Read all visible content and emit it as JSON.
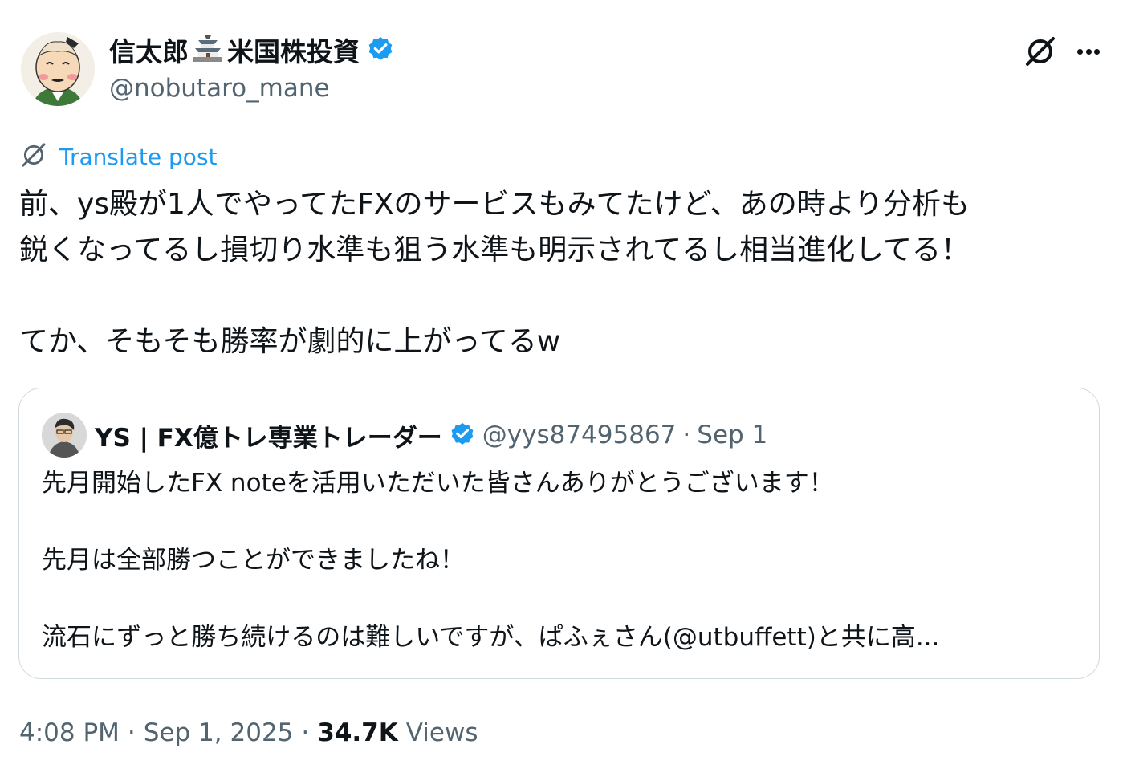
{
  "author": {
    "display_name_prefix": "信太郎",
    "display_name_suffix": "米国株投資",
    "handle": "@nobutaro_mane",
    "icons": [
      "castle-emoji-icon",
      "verified-badge-icon",
      "grok-icon",
      "more-icon"
    ]
  },
  "translate": {
    "label": "Translate post",
    "icon": "translate-icon"
  },
  "tweet": {
    "lines": [
      "前、ys殿が1人でやってたFXのサービスもみてたけど、あの時より分析も",
      "鋭くなってるし損切り水準も狙う水準も明示されてるし相当進化してる！",
      "",
      "てか、そもそも勝率が劇的に上がってるw"
    ]
  },
  "quote": {
    "display_name": "YS | FX億トレ専業トレーダー",
    "handle": "@yys87495867",
    "separator": "·",
    "date": "Sep 1",
    "lines": [
      "先月開始したFX noteを活用いただいた皆さんありがとうございます！",
      "",
      "先月は全部勝つことができましたね！",
      "",
      "流石にずっと勝ち続けるのは難しいですが、ぱふぇさん(@utbuffett)と共に高..."
    ]
  },
  "footer": {
    "time": "4:08 PM",
    "sep1": "·",
    "date": "Sep 1, 2025",
    "sep2": "·",
    "views_count": "34.7K",
    "views_label": "Views"
  },
  "colors": {
    "text": "#0f1419",
    "muted": "#536471",
    "accent": "#1d9bf0",
    "border": "#cfd9de"
  }
}
